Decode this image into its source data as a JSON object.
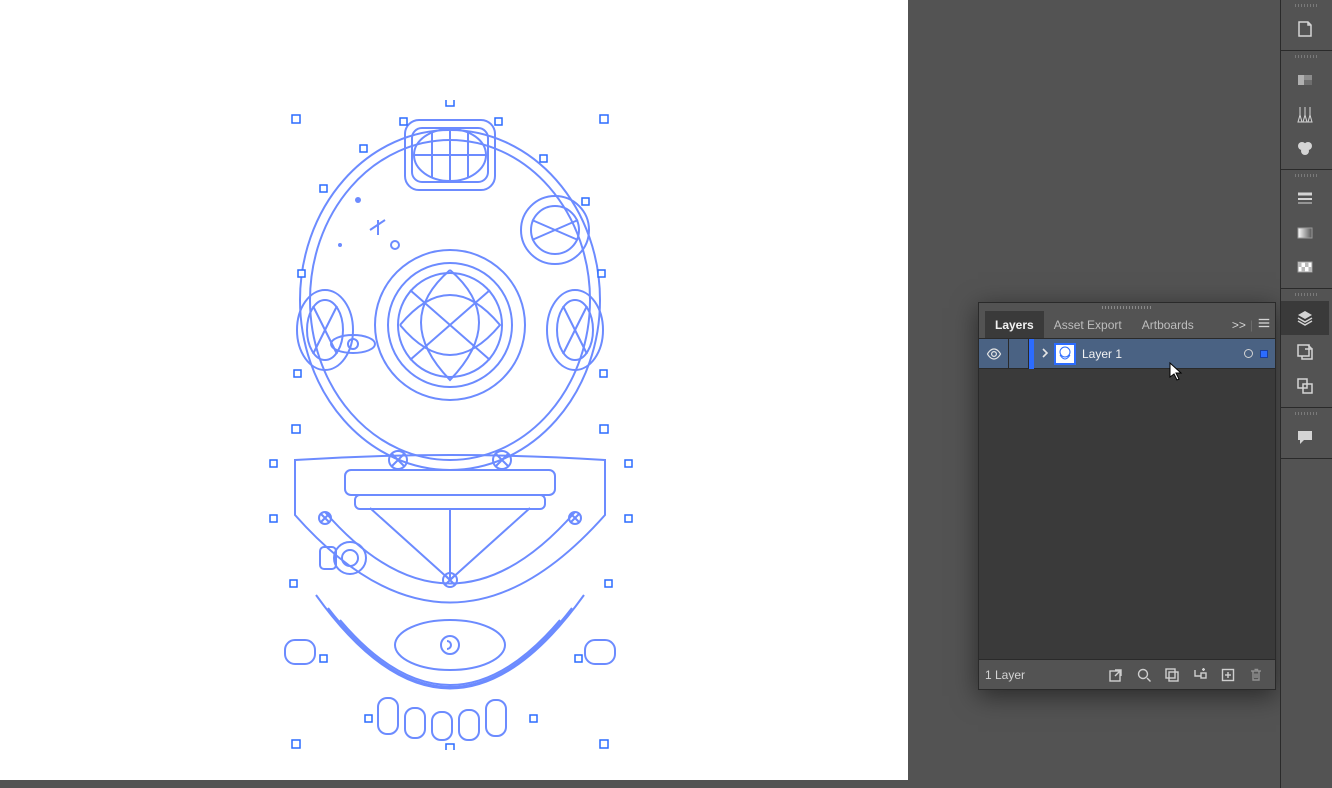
{
  "panel": {
    "tabs": [
      "Layers",
      "Asset Export",
      "Artboards"
    ],
    "active_tab": "Layers",
    "collapse_label": ">>",
    "footer_status": "1 Layer"
  },
  "layers": [
    {
      "name": "Layer 1",
      "visible": true,
      "selected": true,
      "expanded": false,
      "color": "#2c6cff"
    }
  ],
  "dock_icons": [
    {
      "name": "properties",
      "group": 0
    },
    {
      "name": "color",
      "group": 1
    },
    {
      "name": "brushes",
      "group": 1
    },
    {
      "name": "symbols",
      "group": 1
    },
    {
      "name": "stroke",
      "group": 2
    },
    {
      "name": "gradient",
      "group": 2
    },
    {
      "name": "transparency",
      "group": 2
    },
    {
      "name": "layers",
      "group": 3,
      "active": true
    },
    {
      "name": "asset-export",
      "group": 3
    },
    {
      "name": "artboards",
      "group": 3
    },
    {
      "name": "comments",
      "group": 4
    }
  ],
  "artwork_description": "Selected blue outline vector illustration of a vintage diving helmet with visible selection bounding handles",
  "colors": {
    "selection": "#2c6cff",
    "panel_bg": "#535353",
    "panel_dark": "#3a3a3a",
    "row_highlight": "#4a6283"
  }
}
